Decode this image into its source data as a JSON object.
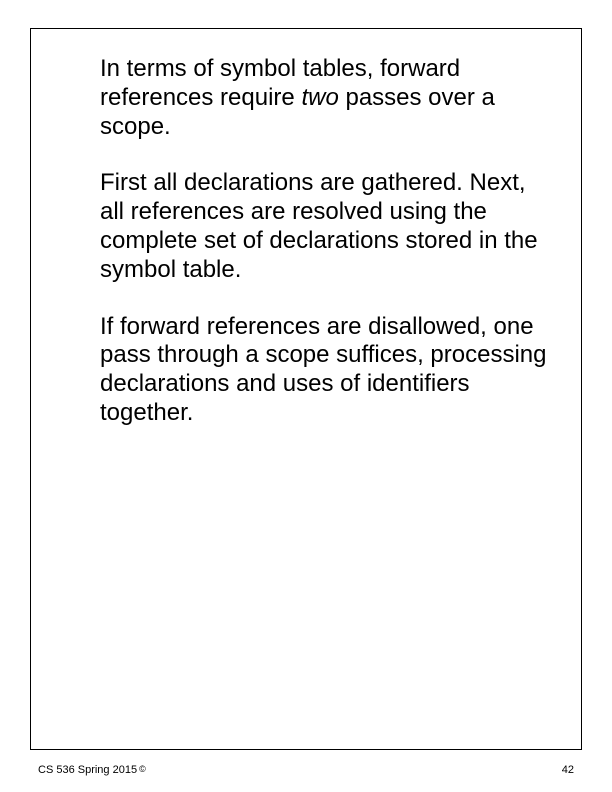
{
  "paragraphs": [
    {
      "segments": [
        {
          "text": "In terms of symbol tables, forward references require ",
          "italic": false
        },
        {
          "text": "two",
          "italic": true
        },
        {
          "text": " passes over a scope.",
          "italic": false
        }
      ]
    },
    {
      "segments": [
        {
          "text": "First all declarations are gathered. Next, all references are resolved using the complete set of declarations stored in the symbol table.",
          "italic": false
        }
      ]
    },
    {
      "segments": [
        {
          "text": "If forward references are disallowed, one pass through a scope suffices, processing declarations and uses of identifiers together.",
          "italic": false
        }
      ]
    }
  ],
  "footer": {
    "course": "CS 536  Spring 2015",
    "copyright_symbol": "©",
    "page_number": "42"
  }
}
